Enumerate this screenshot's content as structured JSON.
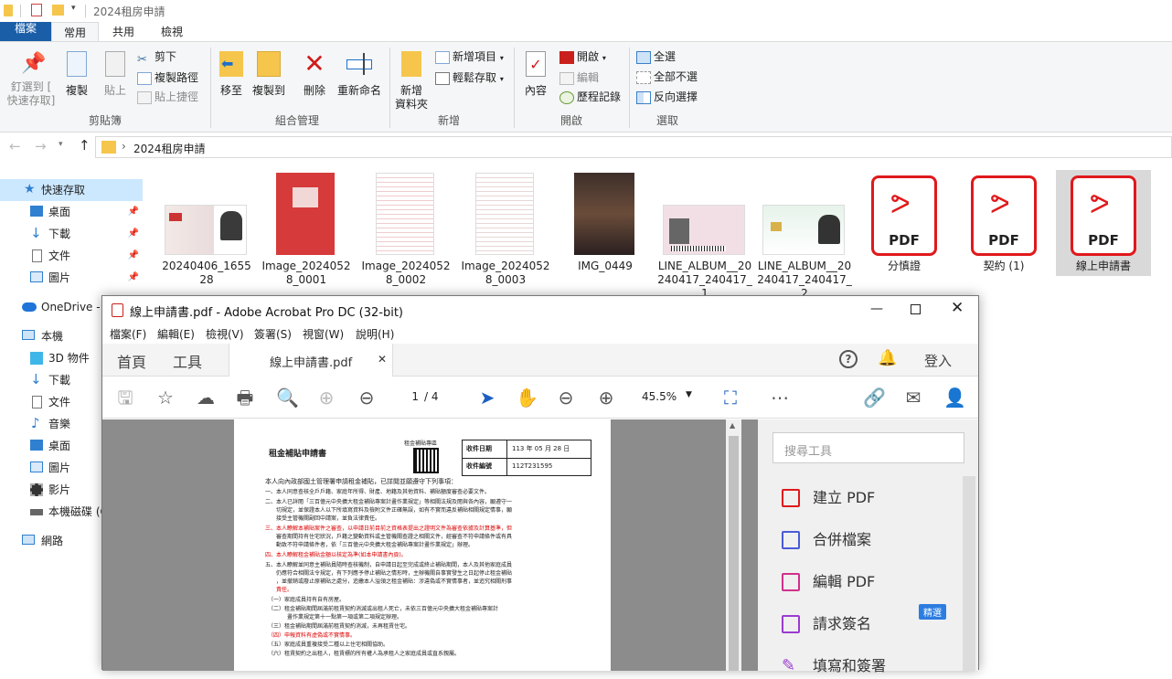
{
  "explorer": {
    "title": "2024租房申請",
    "tabs": [
      "檔案",
      "常用",
      "共用",
      "檢視"
    ],
    "ribbon": {
      "pin_label": "釘選到 [\n快速存取]",
      "copy_label": "複製",
      "paste_label": "貼上",
      "cut_label": "剪下",
      "copy_path_label": "複製路徑",
      "paste_shortcut_label": "貼上捷徑",
      "clipboard_group": "剪貼簿",
      "move_to_label": "移至",
      "copy_to_label": "複製到",
      "delete_label": "刪除",
      "rename_label": "重新命名",
      "organize_group": "組合管理",
      "new_item_label": "新增項目",
      "easy_access_label": "輕鬆存取",
      "new_folder_label": "新增\n資料夾",
      "new_group": "新增",
      "properties_label": "內容",
      "open_label": "開啟",
      "edit_label": "編輯",
      "history_label": "歷程記錄",
      "open_group": "開啟",
      "select_all_label": "全選",
      "select_none_label": "全部不選",
      "invert_label": "反向選擇",
      "select_group": "選取"
    },
    "address": {
      "path": "2024租房申請"
    },
    "nav": {
      "quick_access": "快速存取",
      "desktop": "桌面",
      "downloads": "下載",
      "documents": "文件",
      "pictures": "圖片",
      "onedrive": "OneDrive - P",
      "this_pc": "本機",
      "objects3d": "3D 物件",
      "downloads2": "下載",
      "documents2": "文件",
      "music": "音樂",
      "desktop2": "桌面",
      "pictures2": "圖片",
      "videos": "影片",
      "local_disk": "本機磁碟 (C",
      "network": "網路"
    },
    "files": [
      {
        "name": "20240406_165528"
      },
      {
        "name": "Image_20240528_0001"
      },
      {
        "name": "Image_20240528_0002"
      },
      {
        "name": "Image_20240528_0003"
      },
      {
        "name": "IMG_0449"
      },
      {
        "name": "LINE_ALBUM__20240417_240417_1"
      },
      {
        "name": "LINE_ALBUM__20240417_240417_2"
      },
      {
        "name": "分慎證"
      },
      {
        "name": "契約 (1)"
      },
      {
        "name": "線上申請書"
      }
    ],
    "pdf_badge": "PDF"
  },
  "acrobat": {
    "title": "線上申請書.pdf - Adobe Acrobat Pro DC (32-bit)",
    "menu": [
      "檔案(F)",
      "編輯(E)",
      "檢視(V)",
      "簽署(S)",
      "視窗(W)",
      "說明(H)"
    ],
    "home_tab": "首頁",
    "tools_tab": "工具",
    "doc_tab": "線上申請書.pdf",
    "signin": "登入",
    "page_current": "1",
    "page_total": "/ 4",
    "zoom": "45.5%",
    "search_placeholder": "搜尋工具",
    "right_pane": [
      {
        "label": "建立 PDF"
      },
      {
        "label": "合併檔案"
      },
      {
        "label": "編輯 PDF"
      },
      {
        "label": "請求簽名"
      },
      {
        "label": "填寫和簽署"
      }
    ],
    "badge": "精選",
    "page": {
      "title": "租金補貼申請書",
      "qr_label": "租金補貼專區",
      "recv_date_label": "收件日期",
      "recv_date_value": "113 年 05 月 28 日",
      "recv_no_label": "收件編號",
      "recv_no_value": "112T231595",
      "lines": [
        "本人向內政部國土管理署申請租金補貼，已詳閱並願遵守下列事項：",
        "一、本人同意查核全戶戶籍、家庭年所得、財產、地籍及其他資料、補貼額度審查必要文件。",
        "二、本人已詳閱「三百億元中央擴大租金補貼專案計畫作業規定」等相關法規及閱與各內容，願遵守一",
        "　　切規定，並保證本人以下所填寫資料及檢附文件正確無誤，如有不實而違反補貼相關規定情事，願",
        "　　接受主管機關副回中請案，並負法律責任。",
        "三、本人瞭解本補貼案件之審查，以申請日前目前之資格表提出之證明文件為審查依據及計算基準，但",
        "　　審查期間持有住宅狀況，戶籍之變動資料或主管機關查證之相關文件，經審查不符申請條件或有具",
        "　　動致不符申請條件者，依「三百億元中央擴大租金補貼專案計畫作業規定」辦理。",
        "四、本人瞭解租金補貼金額以核定為準(如本申請書內頁)。",
        "五、本人瞭解並同意主補貼員隨時查核機制，自申請日起至完成或終止補貼期間，本人及其他家庭成員",
        "　　仍應符合相關法令規定，有下列應予停止補貼之情形時，主辦機關自事實發生之日起停止租金補貼",
        "　　，並撤銷或廢止原補貼之處分，追繳本人溢領之租金補貼：涉違偽或不實情事者，並追究相關刑事",
        "　　責任。",
        "　（一）家庭成員持有自有房屋。",
        "　（二）租金補貼期間屆滿前租賃契約消滅或出租人死亡，未依三百億元中央擴大租金補貼專案計",
        "　　　　畫作業規定第十一點第一項或第二項規定辦理。",
        "　（三）租金補貼期間屆滿前租賃契約消滅，未再租賃住宅。",
        "　（四）申報資料有虛偽或不實情事。",
        "　（五）家庭成員重複接受二種以上住宅相關協助。",
        "　（六）租賃契約之出租人，租賃標的所有權人為承租人之家庭成員或直系親屬。"
      ]
    }
  }
}
